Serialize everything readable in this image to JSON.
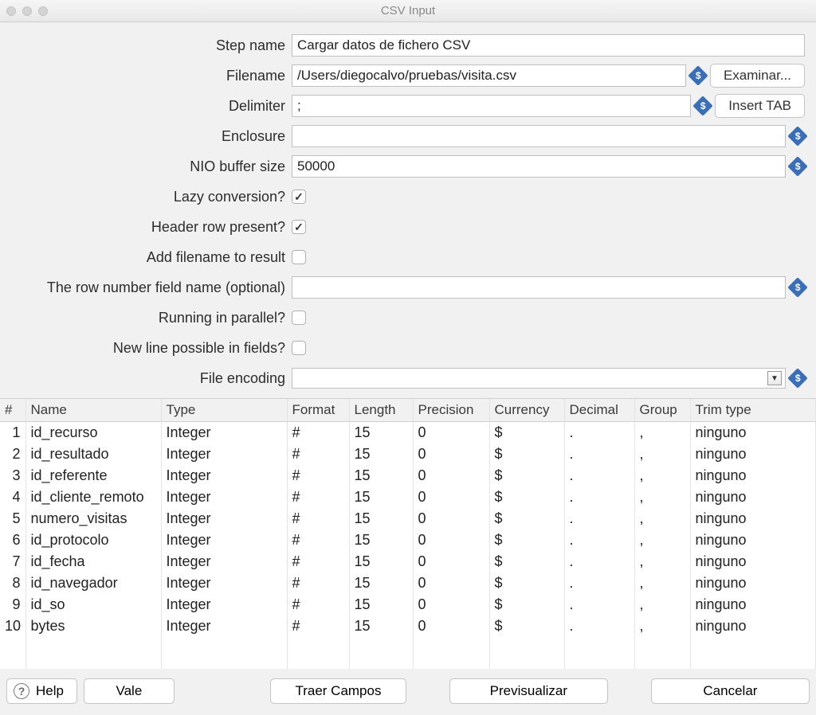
{
  "window": {
    "title": "CSV Input"
  },
  "labels": {
    "step_name": "Step name",
    "filename": "Filename",
    "delimiter": "Delimiter",
    "enclosure": "Enclosure",
    "buffer": "NIO buffer size",
    "lazy": "Lazy conversion?",
    "header": "Header row present?",
    "add_filename": "Add filename to result",
    "row_number": "The row number field name (optional)",
    "parallel": "Running in parallel?",
    "newline": "New line possible in fields?",
    "encoding": "File encoding"
  },
  "values": {
    "step_name": "Cargar datos de fichero CSV",
    "filename": "/Users/diegocalvo/pruebas/visita.csv",
    "delimiter": ";",
    "enclosure": "",
    "buffer": "50000",
    "lazy_checked": true,
    "header_checked": true,
    "add_filename_checked": false,
    "row_number": "",
    "parallel_checked": false,
    "newline_checked": false,
    "encoding": ""
  },
  "buttons": {
    "browse": "Examinar...",
    "insert_tab": "Insert TAB",
    "help": "Help",
    "ok": "Vale",
    "get_fields": "Traer Campos",
    "preview": "Previsualizar",
    "cancel": "Cancelar"
  },
  "var_badge": "$",
  "table": {
    "headers": {
      "num": "#",
      "name": "Name",
      "type": "Type",
      "format": "Format",
      "length": "Length",
      "precision": "Precision",
      "currency": "Currency",
      "decimal": "Decimal",
      "group": "Group",
      "trim": "Trim type"
    },
    "rows": [
      {
        "num": "1",
        "name": "id_recurso",
        "type": "Integer",
        "format": "#",
        "length": "15",
        "precision": "0",
        "currency": "$",
        "decimal": ".",
        "group": ",",
        "trim": "ninguno"
      },
      {
        "num": "2",
        "name": "id_resultado",
        "type": "Integer",
        "format": "#",
        "length": "15",
        "precision": "0",
        "currency": "$",
        "decimal": ".",
        "group": ",",
        "trim": "ninguno"
      },
      {
        "num": "3",
        "name": "id_referente",
        "type": "Integer",
        "format": "#",
        "length": "15",
        "precision": "0",
        "currency": "$",
        "decimal": ".",
        "group": ",",
        "trim": "ninguno"
      },
      {
        "num": "4",
        "name": "id_cliente_remoto",
        "type": "Integer",
        "format": "#",
        "length": "15",
        "precision": "0",
        "currency": "$",
        "decimal": ".",
        "group": ",",
        "trim": "ninguno"
      },
      {
        "num": "5",
        "name": "numero_visitas",
        "type": "Integer",
        "format": "#",
        "length": "15",
        "precision": "0",
        "currency": "$",
        "decimal": ".",
        "group": ",",
        "trim": "ninguno"
      },
      {
        "num": "6",
        "name": "id_protocolo",
        "type": "Integer",
        "format": "#",
        "length": "15",
        "precision": "0",
        "currency": "$",
        "decimal": ".",
        "group": ",",
        "trim": "ninguno"
      },
      {
        "num": "7",
        "name": "id_fecha",
        "type": "Integer",
        "format": "#",
        "length": "15",
        "precision": "0",
        "currency": "$",
        "decimal": ".",
        "group": ",",
        "trim": "ninguno"
      },
      {
        "num": "8",
        "name": "id_navegador",
        "type": "Integer",
        "format": "#",
        "length": "15",
        "precision": "0",
        "currency": "$",
        "decimal": ".",
        "group": ",",
        "trim": "ninguno"
      },
      {
        "num": "9",
        "name": "id_so",
        "type": "Integer",
        "format": "#",
        "length": "15",
        "precision": "0",
        "currency": "$",
        "decimal": ".",
        "group": ",",
        "trim": "ninguno"
      },
      {
        "num": "10",
        "name": "bytes",
        "type": "Integer",
        "format": "#",
        "length": "15",
        "precision": "0",
        "currency": "$",
        "decimal": ".",
        "group": ",",
        "trim": "ninguno"
      }
    ]
  }
}
